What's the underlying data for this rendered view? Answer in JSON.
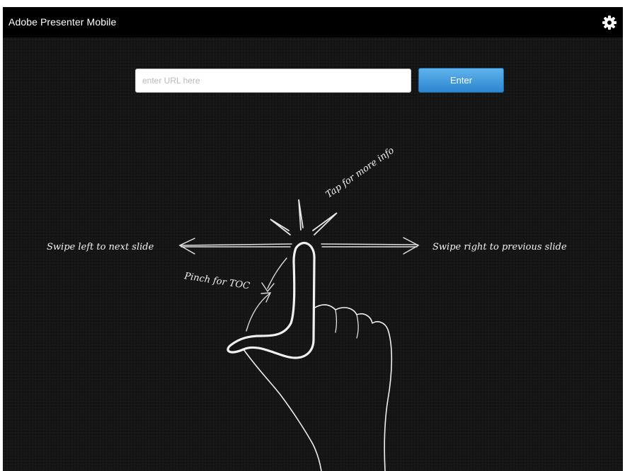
{
  "app": {
    "title": "Adobe Presenter Mobile"
  },
  "toolbar": {
    "settings_icon": "gear-icon"
  },
  "url_bar": {
    "placeholder": "enter URL here",
    "value": ""
  },
  "enter_button": {
    "label": "Enter",
    "color": "#2c86cf"
  },
  "gestures": {
    "tap": "Tap for more info",
    "swipe_left": "Swipe left to next slide",
    "swipe_right": "Swipe right to previous slide",
    "pinch": "Pinch for TOC"
  },
  "colors": {
    "background": "#151515",
    "titlebar": "#000000",
    "stroke": "#e6e6e6"
  }
}
